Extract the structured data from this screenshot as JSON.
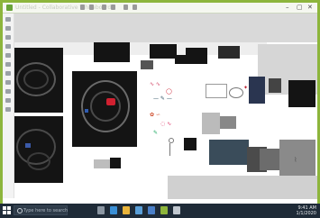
{
  "window": {
    "title": "Untitled - Collaborative Whiteboard",
    "minimize": "–",
    "maximize": "▢",
    "close": "✕"
  },
  "taskbar": {
    "search_placeholder": "Type here to search",
    "time": "9:41 AM",
    "date": "1/1/2020"
  },
  "colors": {
    "frame_border": "#8db53c",
    "taskbar_bg": "#1f2b38",
    "accent_red": "#d02030"
  },
  "toolbar_icons": [
    "back-icon",
    "forward-icon",
    "undo-icon",
    "redo-icon",
    "share-icon",
    "settings-icon"
  ],
  "side_tools": [
    "select-icon",
    "pen-icon",
    "highlighter-icon",
    "eraser-icon",
    "lasso-icon",
    "ruler-icon",
    "text-icon",
    "image-icon",
    "shape-icon",
    "sticky-note-icon",
    "zoom-icon",
    "more-icon"
  ]
}
